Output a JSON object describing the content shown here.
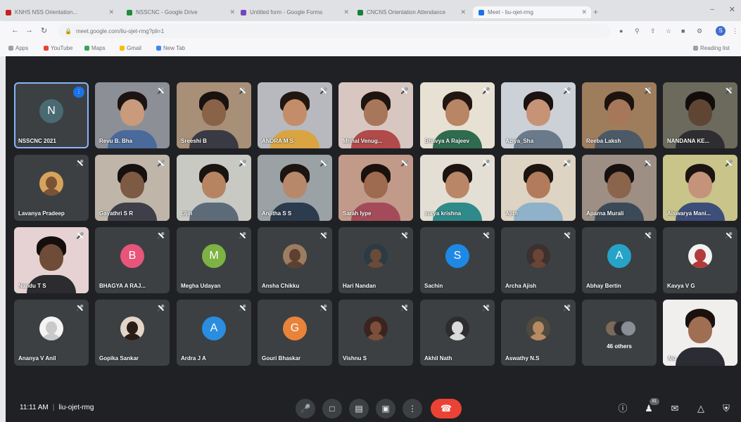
{
  "browser": {
    "tabs": [
      {
        "title": "KNHS NSS Orientation...",
        "color": "#c5221f"
      },
      {
        "title": "NSSCNC - Google Drive",
        "color": "#1e8e3e"
      },
      {
        "title": "Untitled form - Google Forms",
        "color": "#7248b9"
      },
      {
        "title": "CNCNS Orientation Attendance",
        "color": "#188038"
      },
      {
        "title": "Meet - liu-ojet-rmg",
        "color": "#1a73e8",
        "active": true
      }
    ],
    "new_tab": "+",
    "url": "meet.google.com/liu-ojet-rmg?pli=1",
    "bookmarks": [
      {
        "label": "Apps",
        "color": "#9aa0a6"
      },
      {
        "label": "YouTube",
        "color": "#ea4335"
      },
      {
        "label": "Maps",
        "color": "#34a853"
      },
      {
        "label": "Gmail",
        "color": "#fbbc04"
      },
      {
        "label": "New Tab",
        "color": "#4285f4"
      }
    ],
    "reading_list": "Reading list",
    "profile_initial": "S"
  },
  "meeting": {
    "time": "11:11 AM",
    "code": "liu-ojet-rmg",
    "participant_count": "81",
    "others_label": "46 others"
  },
  "participants": [
    {
      "name": "NSSCNC 2021",
      "kind": "avatar",
      "initial": "N",
      "color": "#4a6a72",
      "self": true
    },
    {
      "name": "Revu B. Bha",
      "kind": "video",
      "bg": "#8d8f96",
      "skin": "#c99a7c",
      "hair": "#1c1412",
      "shirt": "#4a6a9c"
    },
    {
      "name": "Sreeshi B",
      "kind": "video",
      "bg": "#a88f78",
      "skin": "#8a6248",
      "hair": "#1a120e",
      "shirt": "#3a3a44"
    },
    {
      "name": "ANDRA M S",
      "kind": "video",
      "bg": "#b7b9bf",
      "skin": "#c48d69",
      "hair": "#221610",
      "shirt": "#d9a441"
    },
    {
      "name": "Mrinal Venug...",
      "kind": "video",
      "bg": "#d7c7c0",
      "skin": "#a8765a",
      "hair": "#1e1410",
      "shirt": "#b14a4a"
    },
    {
      "name": "Bhavya A Rajeev",
      "kind": "video",
      "bg": "#e7e1d3",
      "skin": "#b88565",
      "hair": "#221610",
      "shirt": "#2f6b4f"
    },
    {
      "name": "Aziya_Sha",
      "kind": "video",
      "bg": "#cbd1d6",
      "skin": "#c79376",
      "hair": "#1a1210",
      "shirt": "#6a7a8a"
    },
    {
      "name": "Reeba Laksh",
      "kind": "video",
      "bg": "#9e7d5c",
      "skin": "#a7775a",
      "hair": "#1c130e",
      "shirt": "#4c5a68"
    },
    {
      "name": "NANDANA KE...",
      "kind": "video",
      "bg": "#6b6a5c",
      "skin": "#5f4634",
      "hair": "#120d0a",
      "shirt": "#2e2e32"
    },
    {
      "name": "Lavanya Pradeep",
      "kind": "photo",
      "color": "#d7a35c",
      "skin": "#7a5234"
    },
    {
      "name": "Gayathri S R",
      "kind": "video",
      "bg": "#bfb6a9",
      "skin": "#7d5a44",
      "hair": "#161010",
      "shirt": "#3f3f4a"
    },
    {
      "name": "Lijin",
      "kind": "video",
      "bg": "#c9c9c4",
      "skin": "#b78462",
      "hair": "#1a1410",
      "shirt": "#5d6b79"
    },
    {
      "name": "Anjitha S S",
      "kind": "video",
      "bg": "#9aa2a6",
      "skin": "#b8886a",
      "hair": "#1c1410",
      "shirt": "#2d3b4f"
    },
    {
      "name": "Sarah Iype",
      "kind": "video",
      "bg": "#c29a8a",
      "skin": "#9e6a50",
      "hair": "#1a110c",
      "shirt": "#a44b5a"
    },
    {
      "name": "surya krishna",
      "kind": "video",
      "bg": "#e4dfd5",
      "skin": "#b98767",
      "hair": "#1b1410",
      "shirt": "#2f8a8a"
    },
    {
      "name": "Ajith",
      "kind": "video",
      "bg": "#ddd4c3",
      "skin": "#b27c5c",
      "hair": "#1b140f",
      "shirt": "#8fb1c9"
    },
    {
      "name": "Aparna Murali",
      "kind": "video",
      "bg": "#9d8f83",
      "skin": "#8b644c",
      "hair": "#161010",
      "shirt": "#3c4a58"
    },
    {
      "name": "Aiswarya Mani...",
      "kind": "video",
      "bg": "#c8c48a",
      "skin": "#c4937a",
      "hair": "#1c1410",
      "shirt": "#3e4e7a"
    },
    {
      "name": "Nandu T S",
      "kind": "video",
      "bg": "#e6d2d2",
      "skin": "#6e4c38",
      "hair": "#140e0c",
      "shirt": "#2b2b30"
    },
    {
      "name": "BHAGYA A RAJ...",
      "kind": "avatar",
      "initial": "B",
      "color": "#e8557a"
    },
    {
      "name": "Megha Udayan",
      "kind": "avatar",
      "initial": "M",
      "color": "#7cb342"
    },
    {
      "name": "Ansha Chikku",
      "kind": "photo",
      "color": "#9c7d62",
      "skin": "#5e4030"
    },
    {
      "name": "Hari Nandan",
      "kind": "photo",
      "color": "#2c3a44",
      "skin": "#6b4a38"
    },
    {
      "name": "Sachin",
      "kind": "avatar",
      "initial": "S",
      "color": "#1e88e5"
    },
    {
      "name": "Archa Ajish",
      "kind": "photo",
      "color": "#3d3030",
      "skin": "#6a4434"
    },
    {
      "name": "Abhay Bertin",
      "kind": "avatar",
      "initial": "A",
      "color": "#26a3c9"
    },
    {
      "name": "Kavya V G",
      "kind": "photo",
      "color": "#f2f2f2",
      "skin": "#b23a3a"
    },
    {
      "name": "Ananya V Anil",
      "kind": "photo",
      "color": "#f4f4f4",
      "skin": "#c9c9c9"
    },
    {
      "name": "Gopika Sankar",
      "kind": "photo",
      "color": "#e3d6c8",
      "skin": "#2a1c16"
    },
    {
      "name": "Ardra J A",
      "kind": "avatar",
      "initial": "A",
      "color": "#2a8de0"
    },
    {
      "name": "Gouri Bhaskar",
      "kind": "avatar",
      "initial": "G",
      "color": "#e8833a"
    },
    {
      "name": "Vishnu S",
      "kind": "photo",
      "color": "#3a2420",
      "skin": "#7d4f3a"
    },
    {
      "name": "Akhil Nath",
      "kind": "photo",
      "color": "#2d2d30",
      "skin": "#dadada"
    },
    {
      "name": "Aswathy N.S",
      "kind": "photo",
      "color": "#4e4a3e",
      "skin": "#b88a62"
    },
    {
      "name": "46 others",
      "kind": "others"
    },
    {
      "name": "Aju",
      "kind": "video",
      "bg": "#f1eeee",
      "skin": "#a06e52",
      "hair": "#1a110d",
      "shirt": "#2c2c34",
      "noframe": true
    }
  ],
  "controls": {
    "mic": "mic-off",
    "camera": "camera-off",
    "captions": "cc",
    "present": "present",
    "more": "more",
    "leave": "leave-call"
  },
  "right_controls": [
    "info",
    "people",
    "chat",
    "activities",
    "host-controls"
  ],
  "colors": {
    "meet_bg": "#202124",
    "tile_bg": "#3c4043",
    "hangup": "#ea4335"
  }
}
